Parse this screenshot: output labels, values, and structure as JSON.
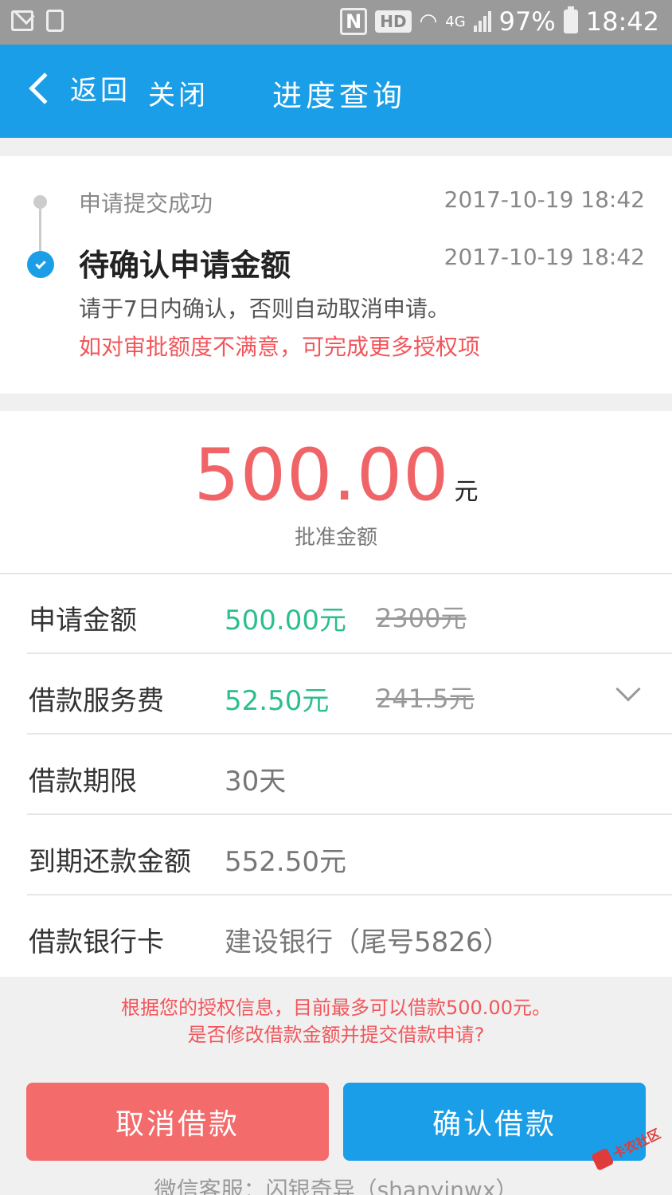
{
  "status_bar": {
    "left_icons": [
      "mail-icon",
      "recycle-icon"
    ],
    "hd": "HD",
    "nfc": "N",
    "network": "4G",
    "battery": "97%",
    "time": "18:42"
  },
  "nav": {
    "back": "返回",
    "close": "关闭",
    "title": "进度查询"
  },
  "progress": {
    "steps": [
      {
        "title": "申请提交成功",
        "time": "2017-10-19 18:42"
      },
      {
        "title": "待确认申请金额",
        "time": "2017-10-19 18:42"
      }
    ],
    "note": "请于7日内确认，否则自动取消申请。",
    "warning": "如对审批额度不满意，可完成更多授权项"
  },
  "approval": {
    "amount": "500.00",
    "unit": "元",
    "label": "批准金额"
  },
  "details": [
    {
      "label": "申请金额",
      "value": "500.00元",
      "original": "2300元"
    },
    {
      "label": "借款服务费",
      "value": "52.50元",
      "original": "241.5元"
    },
    {
      "label": "借款期限",
      "value": "30天"
    },
    {
      "label": "到期还款金额",
      "value": "552.50元"
    },
    {
      "label": "借款银行卡",
      "value": "建设银行（尾号5826）"
    }
  ],
  "notice": {
    "line1": "根据您的授权信息，目前最多可以借款500.00元。",
    "line2": "是否修改借款金额并提交借款申请?"
  },
  "buttons": {
    "cancel": "取消借款",
    "confirm": "确认借款"
  },
  "footer": "微信客服：闪银奇异（shanyinwx）",
  "watermark": "卡农社区",
  "colors": {
    "primary": "#1b9ee8",
    "danger": "#f36b6b",
    "amount_red": "#f06467",
    "green": "#2bbf8c"
  }
}
